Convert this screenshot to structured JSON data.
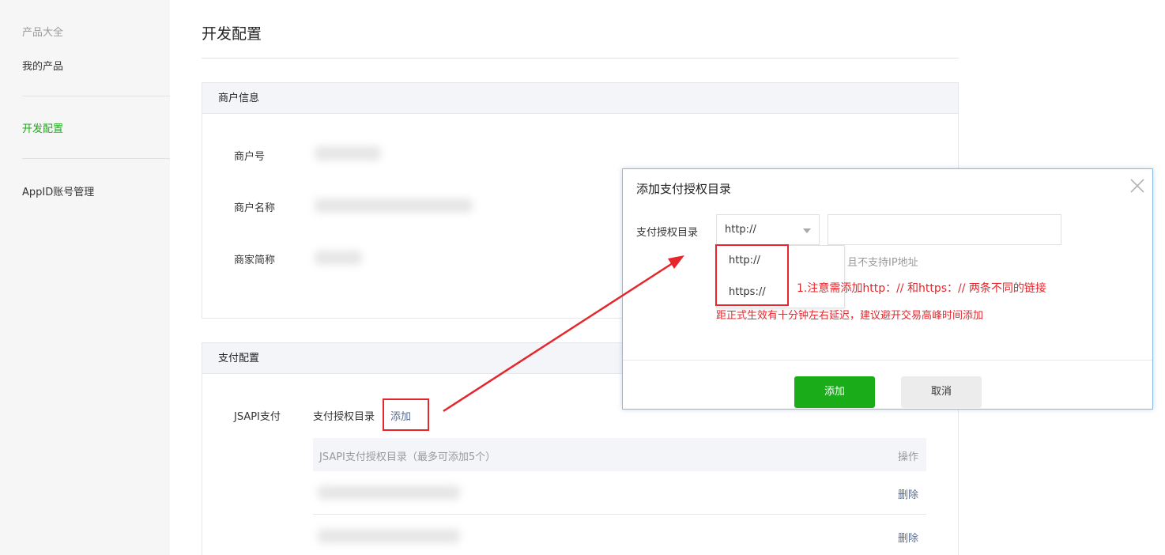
{
  "sidebar": {
    "products_all": "产品大全",
    "my_products": "我的产品",
    "dev_config": "开发配置",
    "appid_manage": "AppID账号管理"
  },
  "page": {
    "title": "开发配置"
  },
  "merchant": {
    "header": "商户信息",
    "id_label": "商户号",
    "name_label": "商户名称",
    "short_label": "商家简称"
  },
  "payment": {
    "header": "支付配置",
    "jsapi_label": "JSAPI支付",
    "auth_dir_label": "支付授权目录",
    "add_link": "添加",
    "table_header": "JSAPI支付授权目录（最多可添加5个）",
    "action_header": "操作",
    "rows": [
      {
        "delete": "删除"
      },
      {
        "delete": "删除"
      }
    ]
  },
  "dialog": {
    "title": "添加支付授权目录",
    "field_label": "支付授权目录",
    "selected_protocol": "http://",
    "options": [
      "http://",
      "https://"
    ],
    "url_input_value": "",
    "hint_gray": "且不支持IP地址",
    "note_red": "1.注意需添加http：// 和https：// 两条不同的链接",
    "hint_red": "距正式生效有十分钟左右延迟，建议避开交易高峰时间添加",
    "confirm_button": "添加",
    "cancel_button": "取消"
  },
  "colors": {
    "brand_green": "#1aad19",
    "link_blue": "#576b95",
    "annotation_red": "#e5262b"
  }
}
